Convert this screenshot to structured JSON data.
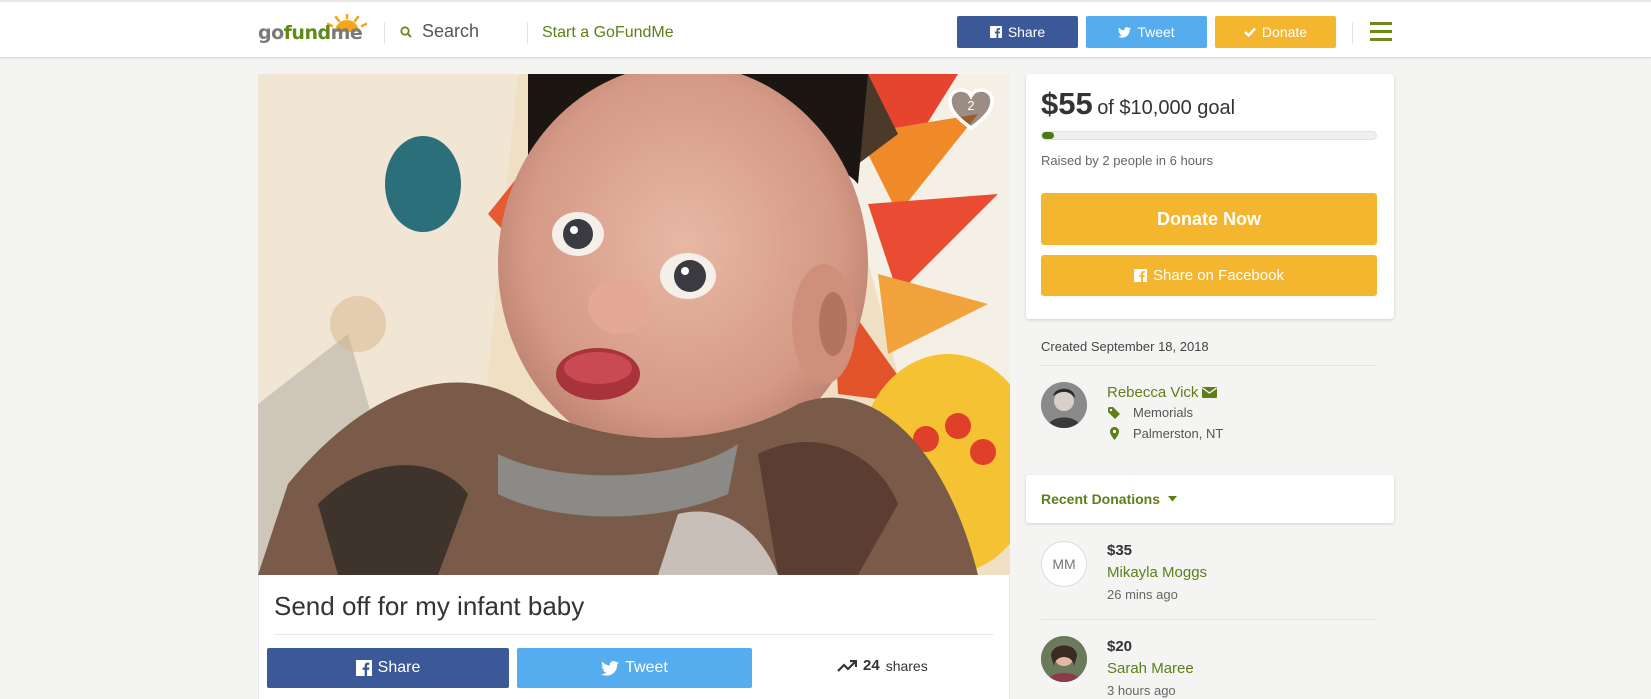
{
  "header": {
    "logo_prefix": "go",
    "logo_highlight": "fund",
    "logo_suffix": "me",
    "search_label": "Search",
    "start_label": "Start a GoFundMe",
    "share_label": "Share",
    "tweet_label": "Tweet",
    "donate_label": "Donate"
  },
  "campaign": {
    "photo_alt": "",
    "heart_count": "2",
    "title": "Send off for my infant baby",
    "share_label": "Share",
    "tweet_label": "Tweet",
    "shares_count": "24",
    "shares_label": "shares"
  },
  "funding": {
    "raised_amount": "$55",
    "goal_text": "of $10,000 goal",
    "progress_fraction": 0.0055,
    "raised_by": "Raised by 2 people in 6 hours",
    "donate_now_label": "Donate Now",
    "share_facebook_label": "Share on Facebook"
  },
  "organizer": {
    "created": "Created September 18, 2018",
    "name": "Rebecca Vick",
    "category": "Memorials",
    "location": "Palmerston, NT"
  },
  "recent_donations": {
    "title": "Recent Donations",
    "items": [
      {
        "initials": "MM",
        "amount": "$35",
        "name": "Mikayla Moggs",
        "time": "26 mins ago"
      },
      {
        "initials": "",
        "amount": "$20",
        "name": "Sarah Maree",
        "time": "3 hours ago"
      }
    ]
  },
  "colors": {
    "facebook": "#3b5998",
    "twitter": "#55acee",
    "donate": "#f4b52f",
    "brand_green": "#5e7e1a"
  }
}
